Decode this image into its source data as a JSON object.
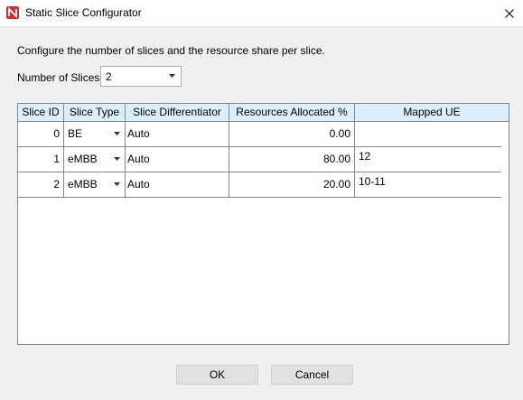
{
  "window": {
    "title": "Static Slice Configurator"
  },
  "description": "Configure the number of slices and the resource share per slice.",
  "num_slices": {
    "label": "Number of Slices",
    "value": "2"
  },
  "table": {
    "headers": [
      "Slice ID",
      "Slice Type",
      "Slice Differentiator",
      "Resources Allocated %",
      "Mapped UE"
    ],
    "rows": [
      {
        "id": "0",
        "type": "BE",
        "diff": "Auto",
        "res": "0.00",
        "ue": ""
      },
      {
        "id": "1",
        "type": "eMBB",
        "diff": "Auto",
        "res": "80.00",
        "ue": "12"
      },
      {
        "id": "2",
        "type": "eMBB",
        "diff": "Auto",
        "res": "20.00",
        "ue": "10-11"
      }
    ]
  },
  "buttons": {
    "ok": "OK",
    "cancel": "Cancel"
  },
  "colors": {
    "header_bg": "#dbeefc",
    "icon_red": "#d32f2f",
    "border": "#828790"
  }
}
